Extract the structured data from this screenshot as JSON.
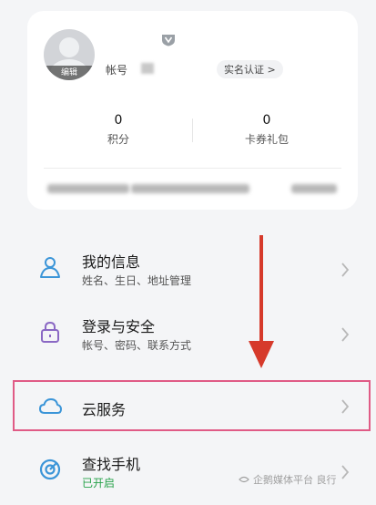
{
  "profile": {
    "avatar_edit_label": "编辑",
    "account_label": "帐号",
    "realname_label": "实名认证 >"
  },
  "stats": {
    "points": {
      "value": "0",
      "label": "积分"
    },
    "coupons": {
      "value": "0",
      "label": "卡券礼包"
    }
  },
  "menu": {
    "my_info": {
      "title": "我的信息",
      "subtitle": "姓名、生日、地址管理",
      "icon": "person-icon"
    },
    "security": {
      "title": "登录与安全",
      "subtitle": "帐号、密码、联系方式",
      "icon": "lock-icon"
    },
    "cloud": {
      "title": "云服务",
      "icon": "cloud-icon"
    },
    "find_phone": {
      "title": "查找手机",
      "subtitle": "已开启",
      "icon": "target-icon"
    }
  },
  "watermark": "企鹅媒体平台 良行",
  "colors": {
    "accent_blue": "#3b95d8",
    "security_purple": "#8a68c4",
    "success_green": "#27a24a",
    "highlight_pink": "#e05b86",
    "arrow_red": "#d63a2b"
  }
}
